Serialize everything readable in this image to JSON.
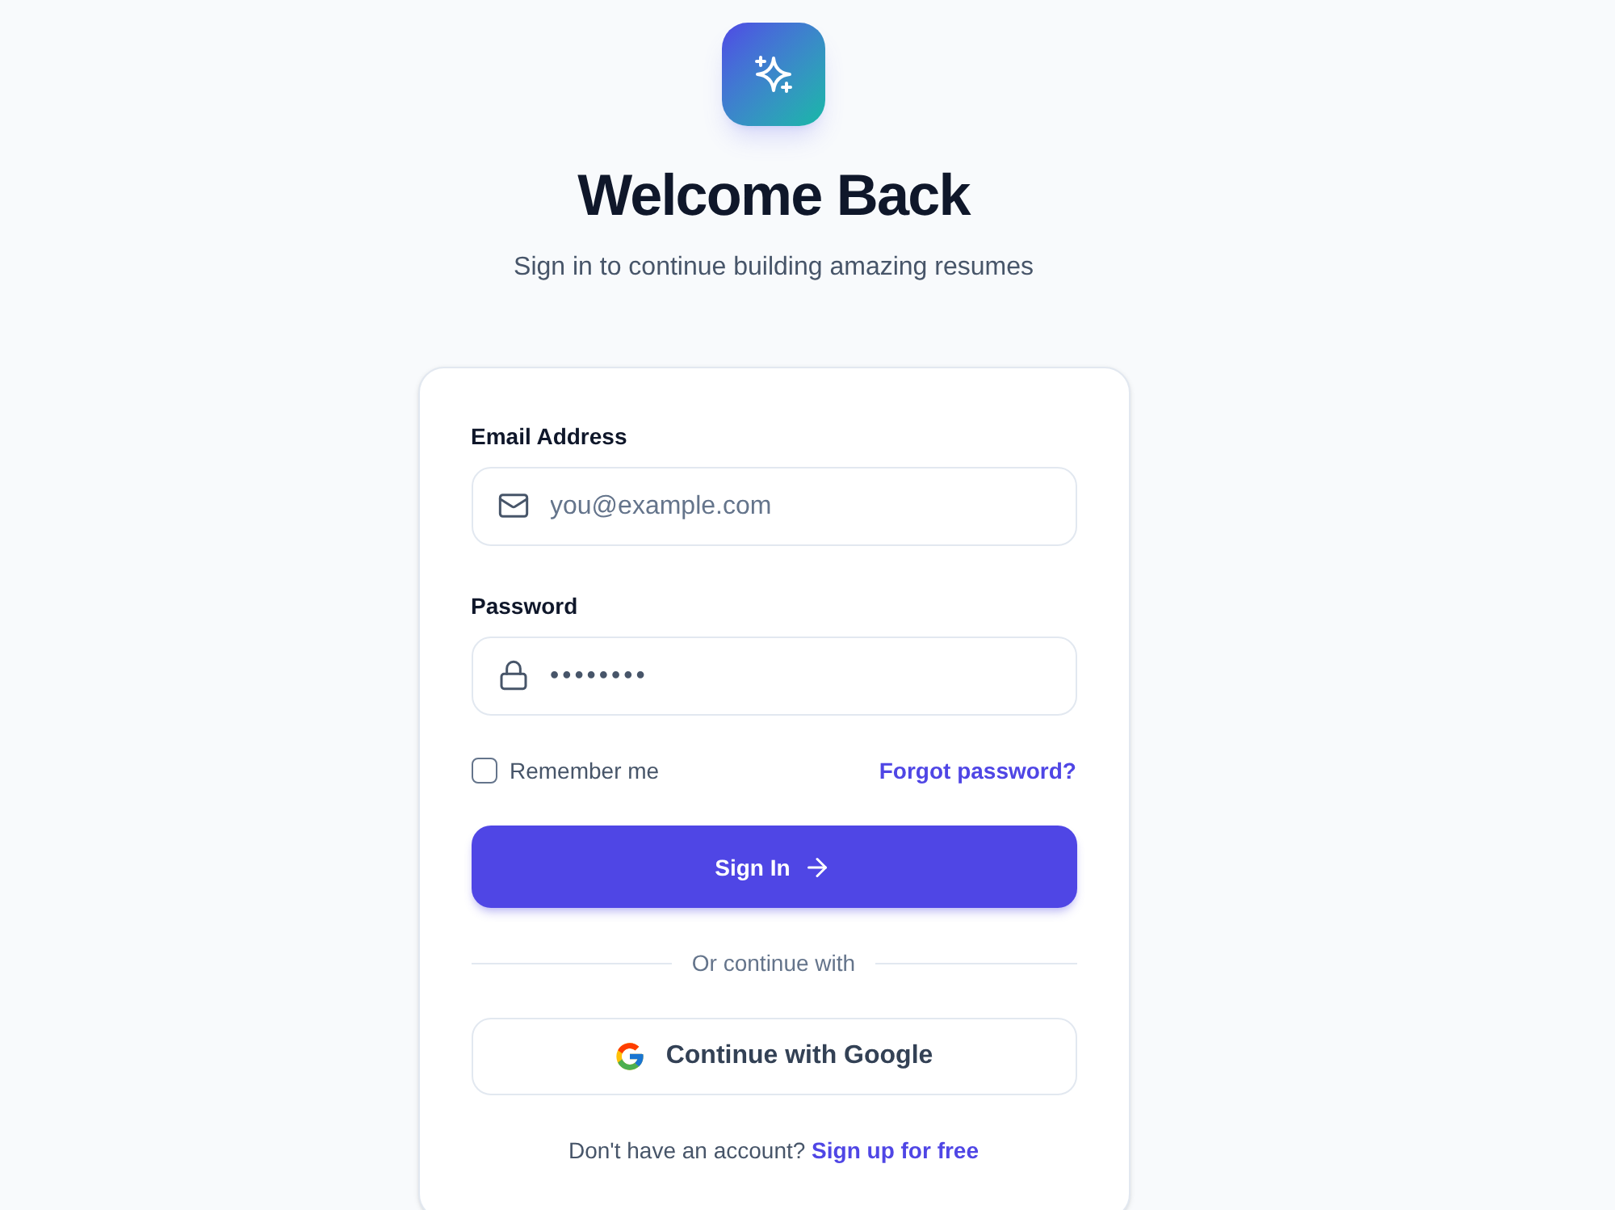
{
  "heading": {
    "title": "Welcome Back",
    "subtitle": "Sign in to continue building amazing resumes"
  },
  "form": {
    "fields": [
      {
        "kind": "email",
        "label": "Email Address",
        "placeholder": "you@example.com"
      },
      {
        "kind": "password",
        "label": "Password",
        "value": "••••••••"
      }
    ],
    "remember": {
      "label": "Remember me",
      "checked": false
    },
    "forgot_link": "Forgot password?",
    "submit_button": "Sign In",
    "divider": "Or continue with",
    "google_button": "Continue with Google",
    "signup": {
      "prompt": "Don't have an account?",
      "link": "Sign up for free"
    }
  }
}
